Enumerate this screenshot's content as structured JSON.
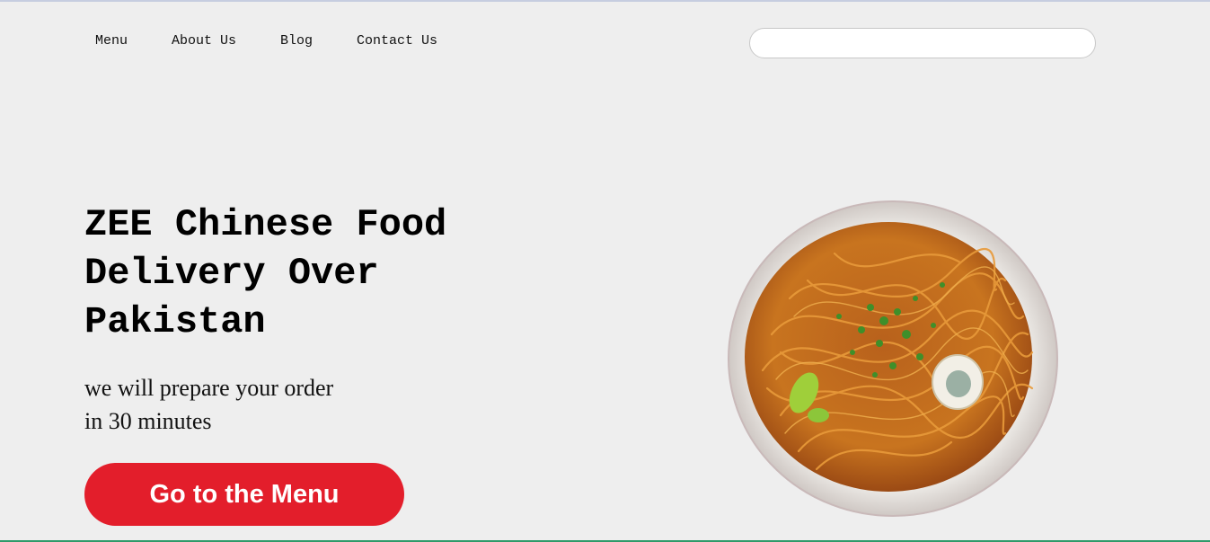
{
  "nav": {
    "items": [
      {
        "label": "Menu"
      },
      {
        "label": "About Us"
      },
      {
        "label": "Blog"
      },
      {
        "label": "Contact Us"
      }
    ]
  },
  "search": {
    "placeholder": ""
  },
  "hero": {
    "title_line1": "ZEE Chinese Food",
    "title_line2": "Delivery Over",
    "title_line3": "Pakistan",
    "subtitle_line1": "we will prepare your order",
    "subtitle_line2": "in 30 minutes",
    "cta_label": "Go to the Menu"
  },
  "colors": {
    "background": "#eeeeee",
    "cta": "#e31e2b",
    "cta_text": "#ffffff"
  }
}
